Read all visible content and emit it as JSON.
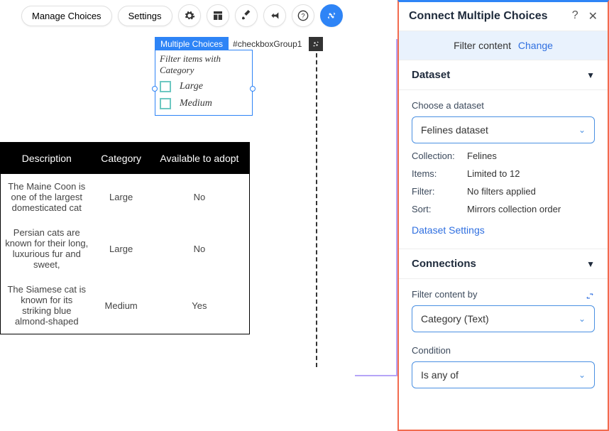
{
  "toolbar": {
    "manage_choices": "Manage Choices",
    "settings": "Settings"
  },
  "element": {
    "tag": "Multiple Choices",
    "id": "#checkboxGroup1"
  },
  "checkbox_group": {
    "title": "Filter items with Category",
    "options": [
      "Large",
      "Medium"
    ]
  },
  "table": {
    "headers": [
      "Description",
      "Category",
      "Available to adopt"
    ],
    "rows": [
      {
        "desc": "The Maine Coon is one of the largest domesticated cat",
        "category": "Large",
        "available": "No"
      },
      {
        "desc": "Persian cats are known for their long, luxurious fur and sweet,",
        "category": "Large",
        "available": "No"
      },
      {
        "desc": "The Siamese cat is known for its striking blue almond-shaped",
        "category": "Medium",
        "available": "Yes"
      }
    ]
  },
  "panel": {
    "title": "Connect Multiple Choices",
    "filter_strip": {
      "label": "Filter content",
      "change": "Change"
    },
    "dataset": {
      "heading": "Dataset",
      "choose_label": "Choose a dataset",
      "selected": "Felines dataset",
      "collection_label": "Collection:",
      "collection_value": "Felines",
      "items_label": "Items:",
      "items_value": "Limited to 12",
      "filter_label": "Filter:",
      "filter_value": "No filters applied",
      "sort_label": "Sort:",
      "sort_value": "Mirrors collection order",
      "settings_link": "Dataset Settings"
    },
    "connections": {
      "heading": "Connections",
      "filter_by_label": "Filter content by",
      "filter_by_value": "Category (Text)",
      "condition_label": "Condition",
      "condition_value": "Is any of"
    }
  }
}
